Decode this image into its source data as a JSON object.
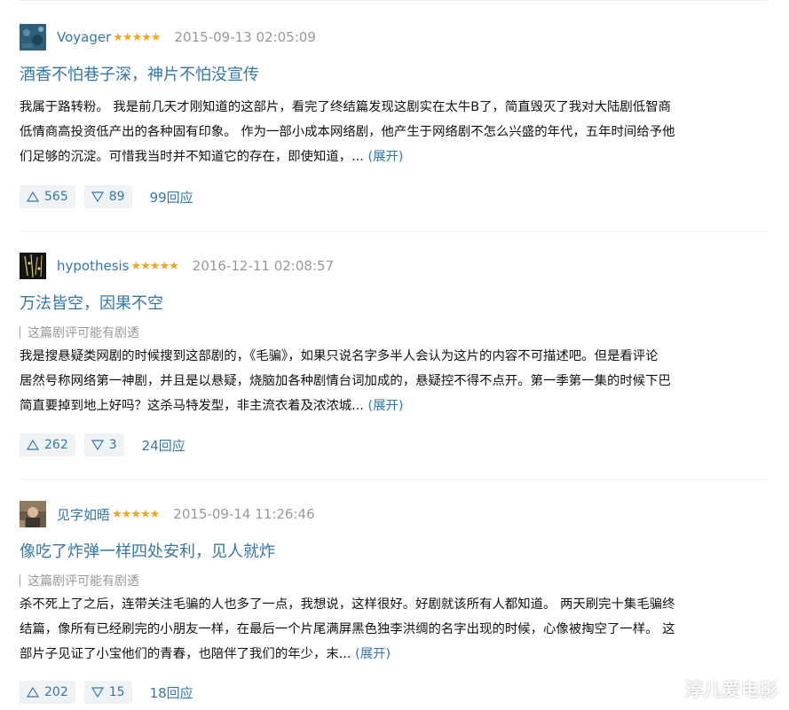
{
  "reviews": [
    {
      "author": "Voyager",
      "stars": "★★★★★",
      "time": "2015-09-13 02:05:09",
      "title": "酒香不怕巷子深，神片不怕没宣传",
      "spoiler": "",
      "body_lines": [
        "我属于路转粉。 我是前几天才刚知道的这部片，看完了终结篇发现这剧实在太牛B了，简直毁灭了我对大陆剧低智商",
        "低情商高投资低产出的各种固有印象。 作为一部小成本网络剧，他产生于网络剧不怎么兴盛的年代，五年时间给予他",
        "们足够的沉淀。可惜我当时并不知道它的存在，即使知道，... "
      ],
      "expand": "(展开)",
      "up": "565",
      "down": "89",
      "replies": "99回应"
    },
    {
      "author": "hypothesis",
      "stars": "★★★★★",
      "time": "2016-12-11 02:08:57",
      "title": "万法皆空，因果不空",
      "spoiler": "这篇剧评可能有剧透",
      "body_lines": [
        "我是搜悬疑类网剧的时候搜到这部剧的，《毛骗》，如果只说名字多半人会认为这片的内容不可描述吧。但是看评论",
        "居然号称网络第一神剧，并且是以悬疑，烧脑加各种剧情台词加成的，悬疑控不得不点开。第一季第一集的时候下巴",
        "简直要掉到地上好吗？这杀马特发型，非主流衣着及浓浓城... "
      ],
      "expand": "(展开)",
      "up": "262",
      "down": "3",
      "replies": "24回应"
    },
    {
      "author": "见字如晤",
      "stars": "★★★★★",
      "time": "2015-09-14 11:26:46",
      "title": "像吃了炸弹一样四处安利，见人就炸",
      "spoiler": "这篇剧评可能有剧透",
      "body_lines": [
        "杀不死上了之后，连带关注毛骗的人也多了一点，我想说，这样很好。好剧就该所有人都知道。 两天刷完十集毛骗终",
        "结篇，像所有已经刷完的小朋友一样，在最后一个片尾满屏黑色独李洪绸的名字出现的时候，心像被掏空了一样。 这",
        "部片子见证了小宝他们的青春，也陪伴了我们的年少，末... "
      ],
      "expand": "(展开)",
      "up": "202",
      "down": "15",
      "replies": "18回应"
    }
  ],
  "watermark": "淳儿爱电影",
  "colors": {
    "link": "#3377aa",
    "star": "#f4a623",
    "muted": "#999999",
    "button_bg": "#f0f3f5"
  },
  "icons": {
    "upvote": "triangle-up-icon",
    "downvote": "triangle-down-icon"
  }
}
